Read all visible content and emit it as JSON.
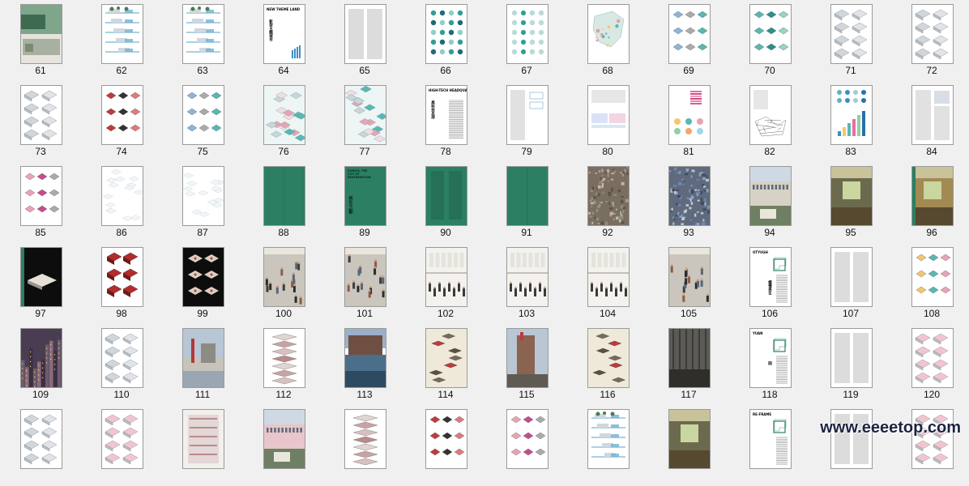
{
  "colors": {
    "accent_green": "#2c7f62",
    "pink": "#e9a3b4",
    "teal": "#5ab7b3",
    "dark": "#1b1b1b"
  },
  "pages": [
    {
      "num": "61",
      "style": "photo-aerial"
    },
    {
      "num": "62",
      "style": "sections"
    },
    {
      "num": "63",
      "style": "sections"
    },
    {
      "num": "64",
      "style": "title-chinese",
      "title": "NEW THEME LAND",
      "cn": "新型主题城市"
    },
    {
      "num": "65",
      "style": "text-columns"
    },
    {
      "num": "66",
      "style": "dot-grid"
    },
    {
      "num": "67",
      "style": "dot-grid-light"
    },
    {
      "num": "68",
      "style": "map"
    },
    {
      "num": "69",
      "style": "diagrams"
    },
    {
      "num": "70",
      "style": "diagrams-teal"
    },
    {
      "num": "71",
      "style": "axonometric"
    },
    {
      "num": "72",
      "style": "axonometric"
    },
    {
      "num": "73",
      "style": "axonometric"
    },
    {
      "num": "74",
      "style": "diagrams-red"
    },
    {
      "num": "75",
      "style": "diagrams"
    },
    {
      "num": "76",
      "style": "iso-pink"
    },
    {
      "num": "77",
      "style": "iso-pink"
    },
    {
      "num": "78",
      "style": "title-text",
      "title": "HIGH-TECH HEADQUARTERS",
      "cn": "高科技总部"
    },
    {
      "num": "79",
      "style": "text-diagram"
    },
    {
      "num": "80",
      "style": "pastel-bands"
    },
    {
      "num": "81",
      "style": "charts-color"
    },
    {
      "num": "82",
      "style": "line-drawing"
    },
    {
      "num": "83",
      "style": "charts-blue"
    },
    {
      "num": "84",
      "style": "text-columns-chart"
    },
    {
      "num": "85",
      "style": "diagrams-pink"
    },
    {
      "num": "86",
      "style": "iso-light"
    },
    {
      "num": "87",
      "style": "iso-light"
    },
    {
      "num": "88",
      "style": "green-plain"
    },
    {
      "num": "89",
      "style": "green-title",
      "title": "DONGXI, THE CITY OF REGENERATION",
      "cn": "再生之都"
    },
    {
      "num": "90",
      "style": "green-text"
    },
    {
      "num": "91",
      "style": "green-plain"
    },
    {
      "num": "92",
      "style": "aerial-dense"
    },
    {
      "num": "93",
      "style": "aerial-dense-blue"
    },
    {
      "num": "94",
      "style": "photo-building"
    },
    {
      "num": "95",
      "style": "photo-interior"
    },
    {
      "num": "96",
      "style": "photo-interior-green"
    },
    {
      "num": "97",
      "style": "black-model"
    },
    {
      "num": "98",
      "style": "model-red"
    },
    {
      "num": "99",
      "style": "black-models"
    },
    {
      "num": "100",
      "style": "photo-crowd"
    },
    {
      "num": "101",
      "style": "photo-crowd"
    },
    {
      "num": "102",
      "style": "photo-exhibit"
    },
    {
      "num": "103",
      "style": "photo-exhibit"
    },
    {
      "num": "104",
      "style": "photo-exhibit"
    },
    {
      "num": "105",
      "style": "photo-crowd"
    },
    {
      "num": "106",
      "style": "title-green-icon",
      "title": "OTYUGH",
      "cn": "缓慢再生"
    },
    {
      "num": "107",
      "style": "text-columns"
    },
    {
      "num": "108",
      "style": "diagrams-color"
    },
    {
      "num": "109",
      "style": "photo-city-night"
    },
    {
      "num": "110",
      "style": "axonometric"
    },
    {
      "num": "111",
      "style": "photo-construction"
    },
    {
      "num": "112",
      "style": "exploded"
    },
    {
      "num": "113",
      "style": "photo-waterfront"
    },
    {
      "num": "114",
      "style": "exploded-beige"
    },
    {
      "num": "115",
      "style": "photo-tower"
    },
    {
      "num": "116",
      "style": "exploded-beige"
    },
    {
      "num": "117",
      "style": "photo-dark"
    },
    {
      "num": "118",
      "style": "title-green-icon",
      "title": "YUAN",
      "cn": "园"
    },
    {
      "num": "119",
      "style": "text-columns"
    },
    {
      "num": "120",
      "style": "axonometric-pink"
    },
    {
      "num": "",
      "style": "axonometric"
    },
    {
      "num": "",
      "style": "axonometric-pink"
    },
    {
      "num": "",
      "style": "photo-plan"
    },
    {
      "num": "",
      "style": "photo-building-pink"
    },
    {
      "num": "",
      "style": "exploded"
    },
    {
      "num": "",
      "style": "diagrams-red"
    },
    {
      "num": "",
      "style": "diagrams-pink"
    },
    {
      "num": "",
      "style": "sections"
    },
    {
      "num": "",
      "style": "photo-interior"
    },
    {
      "num": "",
      "style": "title-green-icon",
      "title": "RE-FRAME",
      "cn": ""
    },
    {
      "num": "",
      "style": "text-columns"
    },
    {
      "num": "",
      "style": "axonometric-pink"
    }
  ],
  "watermark": "www.eeeetop.com"
}
